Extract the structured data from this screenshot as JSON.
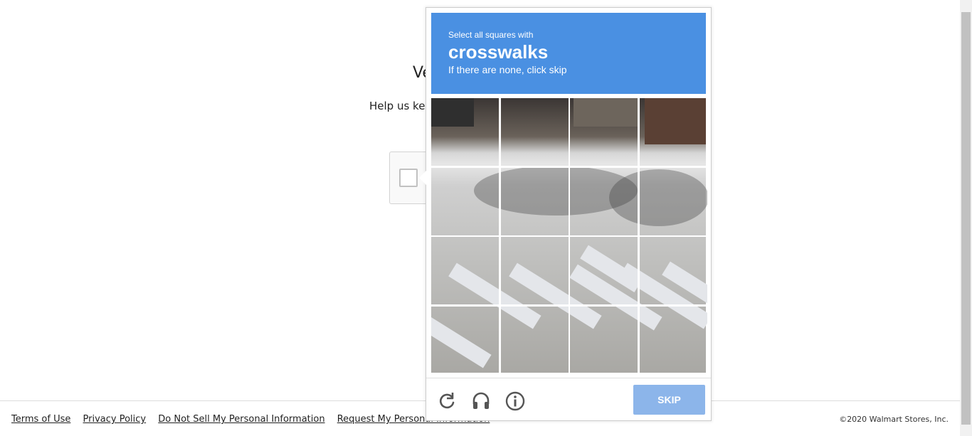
{
  "background": {
    "title": "Ve",
    "subtitle": "Help us kee"
  },
  "challenge": {
    "instruction_small": "Select all squares with",
    "target": "crosswalks",
    "note": "If there are none, click skip",
    "grid": {
      "rows": 4,
      "cols": 4
    },
    "controls": {
      "reload_icon": "reload-icon",
      "audio_icon": "headphones-icon",
      "info_icon": "info-icon"
    },
    "skip_label": "SKIP",
    "header_color": "#4a90e2",
    "skip_color": "#8cb5ea"
  },
  "footer": {
    "links": [
      "Terms of Use",
      "Privacy Policy",
      "Do Not Sell My Personal Information",
      "Request My Personal Information"
    ],
    "copyright": "©2020 Walmart Stores, Inc."
  }
}
